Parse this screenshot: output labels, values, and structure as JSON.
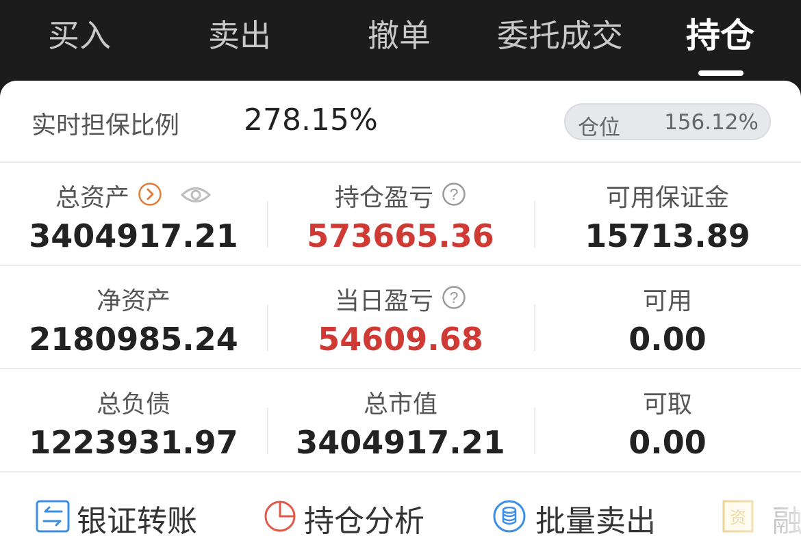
{
  "tabs": [
    {
      "label": "买入",
      "active": false
    },
    {
      "label": "卖出",
      "active": false
    },
    {
      "label": "撤单",
      "active": false
    },
    {
      "label": "委托成交",
      "active": false
    },
    {
      "label": "持仓",
      "active": true
    }
  ],
  "ratio": {
    "label": "实时担保比例",
    "value": "278.15%",
    "position_label": "仓位",
    "position_value": "156.12%"
  },
  "stats": [
    {
      "label": "总资产",
      "value": "3404917.21",
      "color": "#222222",
      "icons": [
        "chevron-right-circle-icon",
        "eye-icon"
      ]
    },
    {
      "label": "持仓盈亏",
      "value": "573665.36",
      "color": "#cf3a35",
      "icons": [
        "question-circle-icon"
      ]
    },
    {
      "label": "可用保证金",
      "value": "15713.89",
      "color": "#222222",
      "icons": []
    },
    {
      "label": "净资产",
      "value": "2180985.24",
      "color": "#222222",
      "icons": []
    },
    {
      "label": "当日盈亏",
      "value": "54609.68",
      "color": "#cf3a35",
      "icons": [
        "question-circle-icon"
      ]
    },
    {
      "label": "可用",
      "value": "0.00",
      "color": "#222222",
      "icons": []
    },
    {
      "label": "总负债",
      "value": "1223931.97",
      "color": "#222222",
      "icons": []
    },
    {
      "label": "总市值",
      "value": "3404917.21",
      "color": "#222222",
      "icons": []
    },
    {
      "label": "可取",
      "value": "0.00",
      "color": "#222222",
      "icons": []
    }
  ],
  "actions": [
    {
      "label": "银证转账",
      "icon": "transfer-icon"
    },
    {
      "label": "持仓分析",
      "icon": "pie-chart-icon"
    },
    {
      "label": "批量卖出",
      "icon": "database-icon"
    },
    {
      "label": "融",
      "icon": "asset-icon",
      "icon_text": "资"
    }
  ],
  "colors": {
    "accent_red": "#cf3a35",
    "icon_blue": "#3a8ee6",
    "icon_orange": "#e07b39",
    "icon_gold": "#e0b040"
  }
}
